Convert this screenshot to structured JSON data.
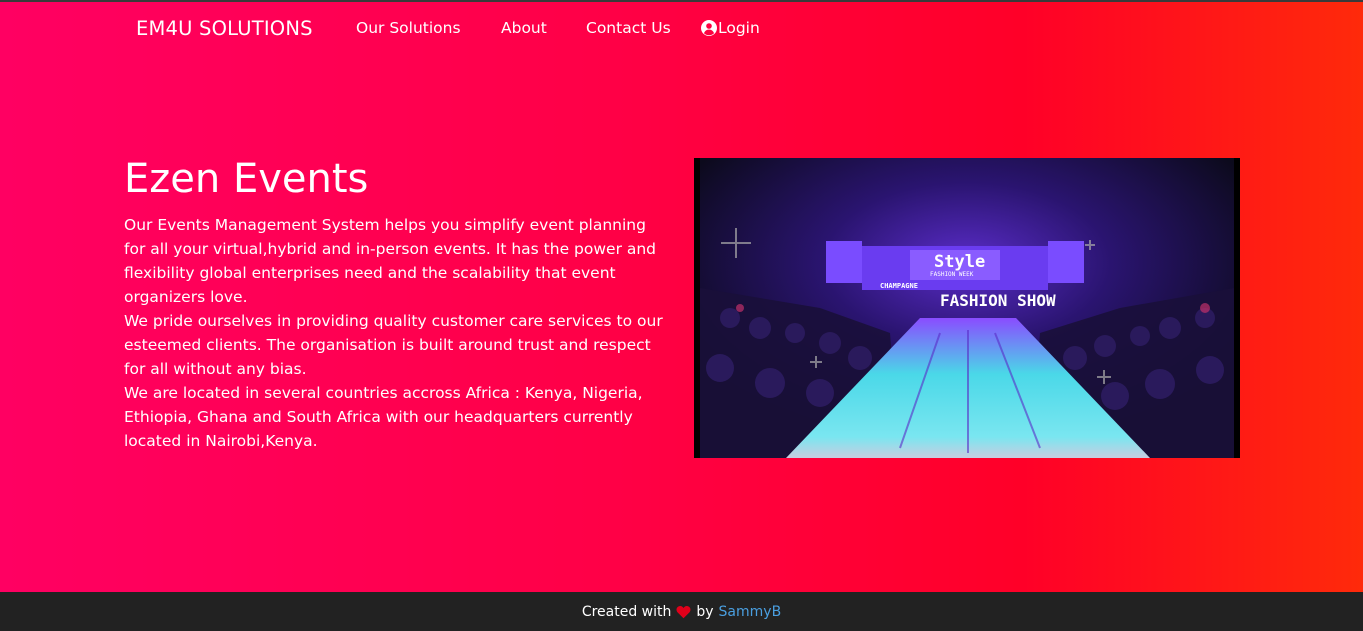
{
  "navbar": {
    "brand": "EM4U SOLUTIONS",
    "links": {
      "solutions": "Our Solutions",
      "about": "About",
      "contact": "Contact Us",
      "login": "Login"
    }
  },
  "hero": {
    "title": "Ezen Events",
    "paragraphs": [
      "Our Events Management System helps you simplify event planning for all your virtual,hybrid and in-person events. It has the power and flexibility global enterprises need and the scalability that event organizers love.",
      "We pride ourselves in providing quality customer care services to our esteemed clients. The organisation is built around trust and respect for all without any bias.",
      "We are located in several countries accross Africa : Kenya, Nigeria, Ethiopia, Ghana and South Africa with our headquarters currently located in Nairobi,Kenya."
    ],
    "image": {
      "banner_text": "FASHION SHOW",
      "logo_text": "Style",
      "logo_subtext": "FASHION WEEK",
      "sponsor_text": "CHAMPAGNE"
    }
  },
  "footer": {
    "prefix": "Created with",
    "middle": "by",
    "author": "SammyB"
  },
  "colors": {
    "gradient_start": "#ff0062",
    "gradient_end": "#ff2a0a",
    "footer_bg": "#222222",
    "heart": "#e0001a",
    "link": "#4a9fe0"
  }
}
